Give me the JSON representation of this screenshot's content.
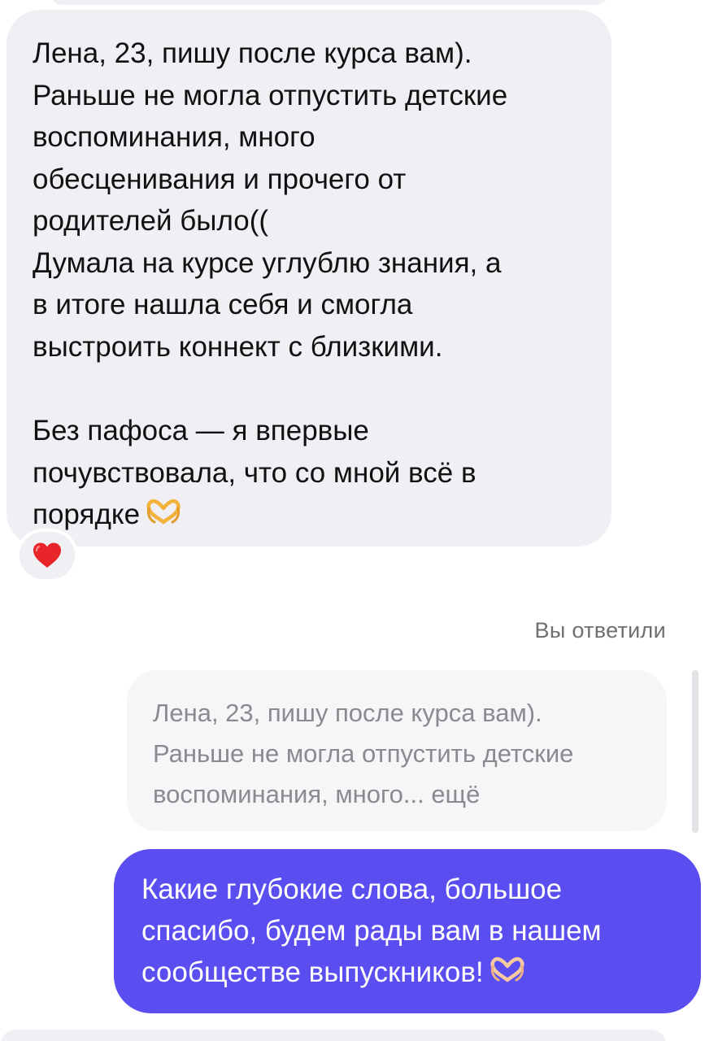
{
  "chat": {
    "incoming": {
      "lines_p1": [
        "Лена, 23, пишу после курса вам).",
        "Раньше не могла отпустить детские",
        "воспоминания, много",
        "обесценивания и прочего от",
        "родителей было(("
      ],
      "lines_p2": [
        "Думала на курсе углублю знания, а",
        "в итоге нашла себя и смогла",
        "выстроить коннект с близкими."
      ],
      "lines_p3": [
        "Без пафоса — я впервые",
        "почувствовала, что со мной всё в",
        "порядке"
      ],
      "emoji": "heart-hands-emoji",
      "reaction": "red-heart-emoji"
    },
    "replied_label": "Вы ответили",
    "quote": {
      "lines": [
        "Лена, 23, пишу после курса вам).",
        "Раньше не могла отпустить детские",
        "воспоминания, много... ещё"
      ]
    },
    "outgoing": {
      "lines": [
        "Какие глубокие слова, большое",
        "спасибо, будем рады вам в нашем",
        "сообществе выпускников!"
      ],
      "emoji": "heart-hands-emoji"
    }
  },
  "colors": {
    "incoming_bg": "#efeff4",
    "outgoing_bg": "#5b4ef0",
    "quote_text": "#8a8a8f",
    "label_text": "#6e6e73"
  }
}
